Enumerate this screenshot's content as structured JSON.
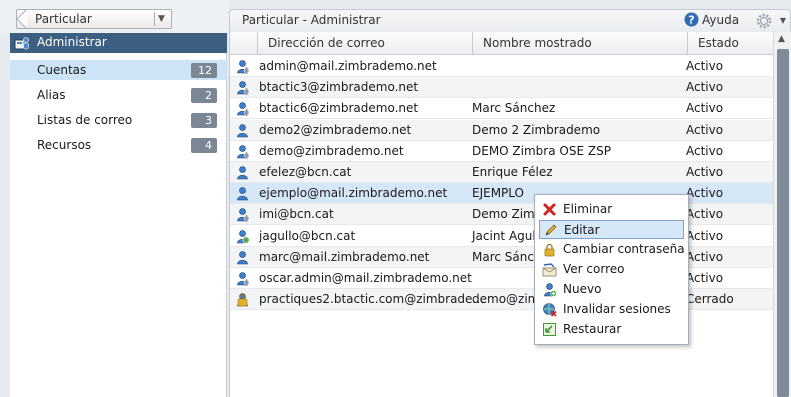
{
  "nav": {
    "selector_label": "Particular",
    "header_label": "Administrar",
    "items": [
      {
        "label": "Cuentas",
        "count": "12"
      },
      {
        "label": "Alias",
        "count": "2"
      },
      {
        "label": "Listas de correo",
        "count": "3"
      },
      {
        "label": "Recursos",
        "count": "4"
      }
    ]
  },
  "content": {
    "title": "Particular - Administrar",
    "help_label": "Ayuda",
    "columns": {
      "email": "Dirección de correo",
      "name": "Nombre mostrado",
      "status": "Estado"
    },
    "rows": [
      {
        "email": "admin@mail.zimbrademo.net",
        "name": "",
        "status": "Activo",
        "icon": "admin-user-icon"
      },
      {
        "email": "btactic3@zimbrademo.net",
        "name": "",
        "status": "Activo",
        "icon": "admin-user-icon"
      },
      {
        "email": "btactic6@zimbrademo.net",
        "name": "Marc Sánchez",
        "status": "Activo",
        "icon": "admin-user-icon"
      },
      {
        "email": "demo2@zimbrademo.net",
        "name": "Demo 2 Zimbrademo",
        "status": "Activo",
        "icon": "user-icon"
      },
      {
        "email": "demo@zimbrademo.net",
        "name": "DEMO Zimbra OSE ZSP",
        "status": "Activo",
        "icon": "admin-user-icon"
      },
      {
        "email": "efelez@bcn.cat",
        "name": "Enrique Félez",
        "status": "Activo",
        "icon": "user-icon"
      },
      {
        "email": "ejemplo@mail.zimbrademo.net",
        "name": "EJEMPLO",
        "status": "Activo",
        "icon": "user-icon"
      },
      {
        "email": "imi@bcn.cat",
        "name": "Demo Zimb",
        "status": "Activo",
        "icon": "admin-user-icon"
      },
      {
        "email": "jagullo@bcn.cat",
        "name": "Jacint Agull",
        "status": "Activo",
        "icon": "global-admin-icon"
      },
      {
        "email": "marc@mail.zimbrademo.net",
        "name": "Marc Sánch",
        "status": "Activo",
        "icon": "user-icon"
      },
      {
        "email": "oscar.admin@mail.zimbrademo.net",
        "name": "",
        "status": "Activo",
        "icon": "admin-user-icon"
      },
      {
        "email": "practiques2.btactic.com@zimbrade…",
        "name": "demo@zim",
        "status": "Cerrado",
        "icon": "locked-user-icon"
      }
    ]
  },
  "context_menu": {
    "items": [
      {
        "label": "Eliminar",
        "icon": "delete-icon"
      },
      {
        "label": "Editar",
        "icon": "edit-icon"
      },
      {
        "label": "Cambiar contraseña",
        "icon": "lock-icon"
      },
      {
        "label": "Ver correo",
        "icon": "view-mail-icon"
      },
      {
        "label": "Nuevo",
        "icon": "new-user-icon"
      },
      {
        "label": "Invalidar sesiones",
        "icon": "invalidate-sessions-icon"
      },
      {
        "label": "Restaurar",
        "icon": "restore-icon"
      }
    ]
  },
  "colors": {
    "header_blue": "#3d5f82",
    "selection": "#cde4f7",
    "count_badge": "#7c8795"
  }
}
